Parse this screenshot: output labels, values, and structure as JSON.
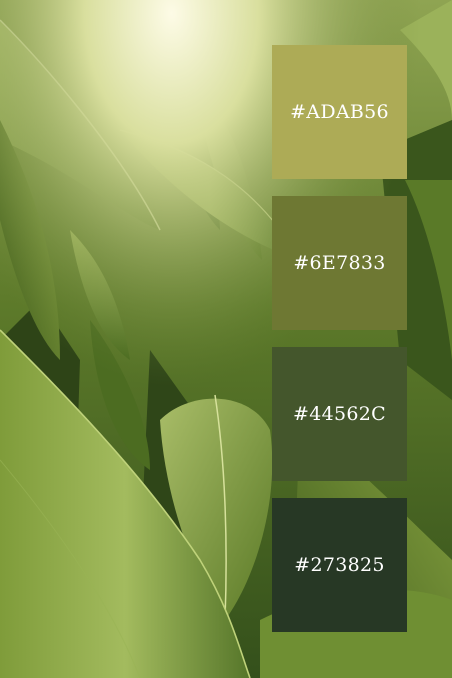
{
  "palette": {
    "swatches": [
      {
        "label": "#ADAB56",
        "color": "#ADAB56"
      },
      {
        "label": "#6E7833",
        "color": "#6E7833"
      },
      {
        "label": "#44562C",
        "color": "#44562C"
      },
      {
        "label": "#273825",
        "color": "#273825"
      }
    ]
  },
  "background": {
    "subject": "green-banana-leaves",
    "colors": {
      "sky_glow": "#fbf8dc",
      "light_leaf": "#9fb163",
      "mid_leaf": "#6e8a35",
      "dark_leaf": "#2f4418"
    }
  }
}
